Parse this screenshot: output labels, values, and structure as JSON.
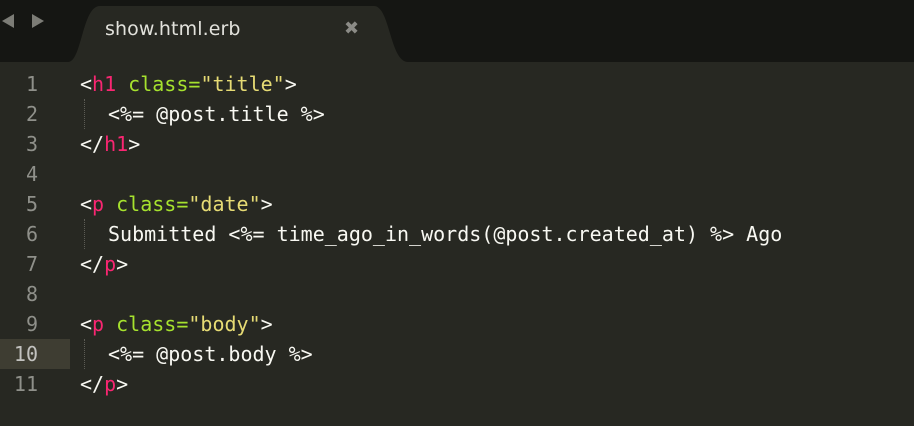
{
  "tab": {
    "title": "show.html.erb",
    "close_glyph": "✖"
  },
  "nav": {
    "back_icon": "triangle-left-icon",
    "forward_icon": "triangle-right-icon"
  },
  "colors": {
    "background": "#272822",
    "tag": "#f92672",
    "attribute": "#a6e22e",
    "string": "#e6db74",
    "text": "#f8f8f2",
    "line_number": "#8f908a"
  },
  "editor": {
    "current_line": 10,
    "lines": [
      {
        "n": "1",
        "open": "<",
        "tag": "h1",
        "attr": " class=",
        "val": "\"title\"",
        "close": ">"
      },
      {
        "n": "2",
        "text": "<%= @post.title %>"
      },
      {
        "n": "3",
        "open": "</",
        "tag": "h1",
        "close": ">"
      },
      {
        "n": "4"
      },
      {
        "n": "5",
        "open": "<",
        "tag": "p",
        "attr": " class=",
        "val": "\"date\"",
        "close": ">"
      },
      {
        "n": "6",
        "text": "Submitted <%= time_ago_in_words(@post.created_at) %> Ago"
      },
      {
        "n": "7",
        "open": "</",
        "tag": "p",
        "close": ">"
      },
      {
        "n": "8"
      },
      {
        "n": "9",
        "open": "<",
        "tag": "p",
        "attr": " class=",
        "val": "\"body\"",
        "close": ">"
      },
      {
        "n": "10",
        "text": "<%= @post.body %>"
      },
      {
        "n": "11",
        "open": "</",
        "tag": "p",
        "close": ">"
      }
    ]
  }
}
